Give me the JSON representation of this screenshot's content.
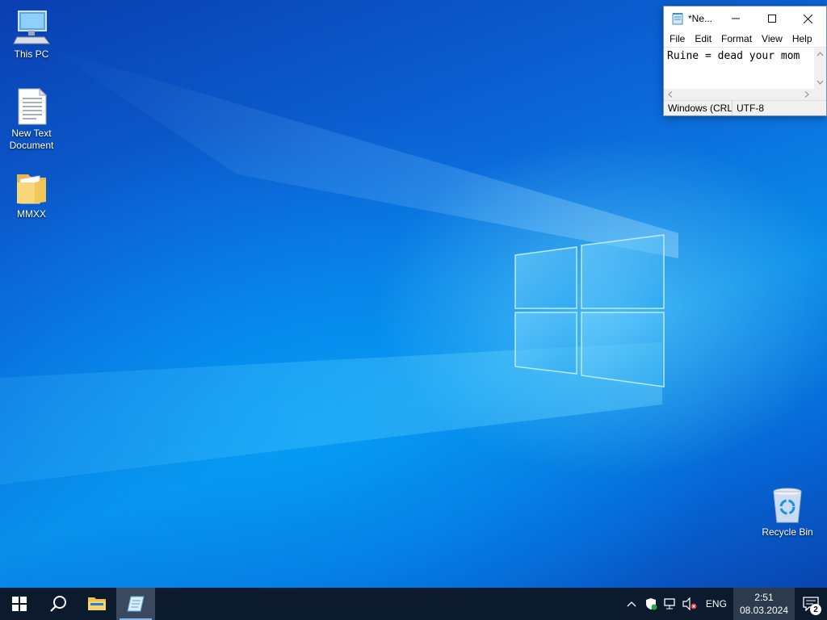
{
  "desktop": {
    "icons": [
      {
        "label": "This PC",
        "icon": "computer-icon"
      },
      {
        "label": "New Text Document",
        "icon": "text-document-icon"
      },
      {
        "label": "MMXX",
        "icon": "folder-icon"
      },
      {
        "label": "Recycle Bin",
        "icon": "recycle-bin-icon"
      }
    ]
  },
  "notepad": {
    "title": "*Ne...",
    "menu": [
      "File",
      "Edit",
      "Format",
      "View",
      "Help"
    ],
    "content": "Ruine = dead your mom",
    "status": {
      "line_ending": "Windows (CRL",
      "encoding": "UTF-8"
    }
  },
  "taskbar": {
    "buttons": [
      "start-icon",
      "search-icon",
      "file-explorer-icon",
      "notepad-icon"
    ],
    "tray": {
      "language": "ENG",
      "time": "2:51",
      "date": "08.03.2024",
      "notification_count": "2"
    }
  }
}
